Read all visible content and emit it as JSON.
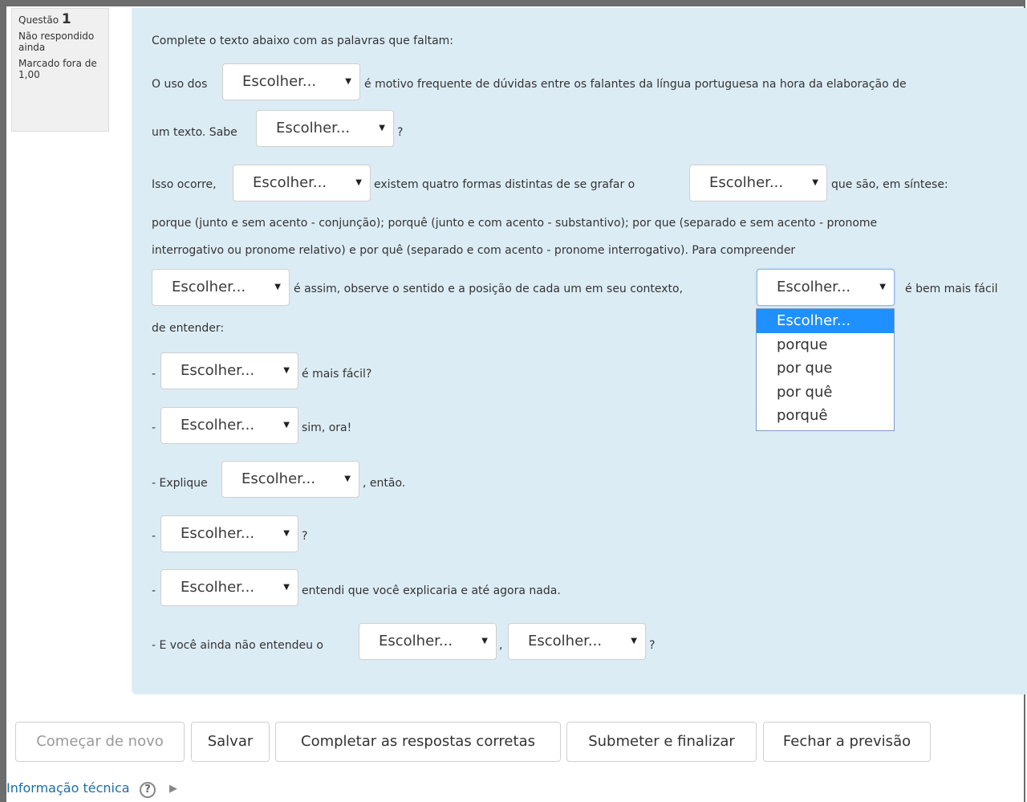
{
  "question_info": {
    "label": "Questão",
    "number": "1",
    "state": "Não respondido ainda",
    "grade": "Marcado fora de 1,00"
  },
  "select_default": "Escolher...",
  "text": {
    "instructions": "Complete o texto abaixo com as palavras que faltam:",
    "l2a": "O uso dos",
    "l2b": "é motivo frequente de dúvidas entre os falantes da língua portuguesa na hora da elaboração de",
    "l3a": "um texto. Sabe",
    "l3b": "?",
    "l4a": "Isso ocorre,",
    "l4b": "existem quatro formas distintas de se grafar o",
    "l4c": "que são, em síntese:",
    "l5": "porque (junto e sem acento - conjunção); porquê (junto e com acento - substantivo); por que (separado e sem acento - pronome",
    "l6": "interrogativo ou pronome relativo) e por quê (separado e com acento - pronome interrogativo). Para compreender",
    "l7a": "é assim, observe o sentido e a posição de cada um em seu contexto,",
    "l7b": "é bem mais fácil",
    "l8": "de entender:",
    "dash": "-",
    "l9": "é mais fácil?",
    "l10": "sim, ora!",
    "l11a": "- Explique",
    "l11b": ", então.",
    "l12": "?",
    "l13": "entendi que você explicaria e até agora nada.",
    "l14a": "- E você ainda não entendeu o",
    "l14b": ",",
    "l14c": "?"
  },
  "dropdown_options": [
    "Escolher...",
    "porque",
    "por que",
    "por quê",
    "porquê"
  ],
  "buttons": {
    "restart": "Começar de novo",
    "save": "Salvar",
    "fill_correct": "Completar as respostas corretas",
    "submit": "Submeter e finalizar",
    "close_preview": "Fechar a previsão"
  },
  "tech_info": "Informação técnica",
  "icons": {
    "help": "?",
    "caret": "▶",
    "select_arrow": "▼"
  }
}
